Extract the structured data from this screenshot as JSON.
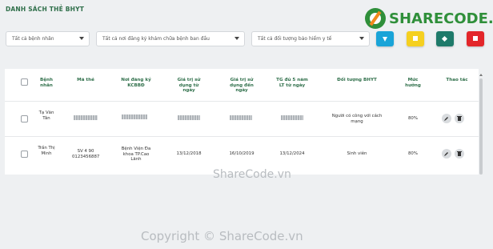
{
  "page": {
    "title": "DANH SÁCH THẺ BHYT"
  },
  "logo": {
    "text_a": "SHARE",
    "text_b": "CODE.vn"
  },
  "filters": {
    "patient": "Tất cả bệnh nhân",
    "facility": "Tất cả nơi đăng ký khám chữa bệnh ban đầu",
    "subject": "Tất cả đối tượng bảo hiểm y tế"
  },
  "actions": [
    {
      "name": "filter-button",
      "icon": "funnel-icon",
      "color": "#19a4d8"
    },
    {
      "name": "add-button",
      "icon": "square-icon",
      "color": "#f5d020"
    },
    {
      "name": "export-button",
      "icon": "diamond-icon",
      "color": "#1e7a6a"
    },
    {
      "name": "delete-button",
      "icon": "trash-icon",
      "color": "#e3262a"
    }
  ],
  "table": {
    "headers": [
      "Bệnh nhân",
      "Mã thẻ",
      "Nơi đăng ký KCBBĐ",
      "Giá trị sử dụng từ ngày",
      "Giá trị sử dụng đến ngày",
      "TG đủ 5 năm LT từ ngày",
      "Đối tượng BHYT",
      "Mức hưởng",
      "Thao tác"
    ],
    "rows": [
      {
        "patient": "Tạ Văn Tân",
        "card": "",
        "facility": "",
        "from": "",
        "to": "",
        "five_years": "",
        "subject": "Người có công với cách mạng",
        "rate": "80%"
      },
      {
        "patient": "Trần Thị Minh",
        "card": "SV 4 90 0123456887",
        "facility": "Bệnh Viện Đa khoa TP.Cao Lãnh",
        "from": "13/12/2018",
        "to": "16/10/2019",
        "five_years": "13/12/2024",
        "subject": "Sinh viên",
        "rate": "80%"
      }
    ]
  },
  "watermark": {
    "mid": "ShareCode.vn",
    "bottom": "Copyright © ShareCode.vn"
  }
}
